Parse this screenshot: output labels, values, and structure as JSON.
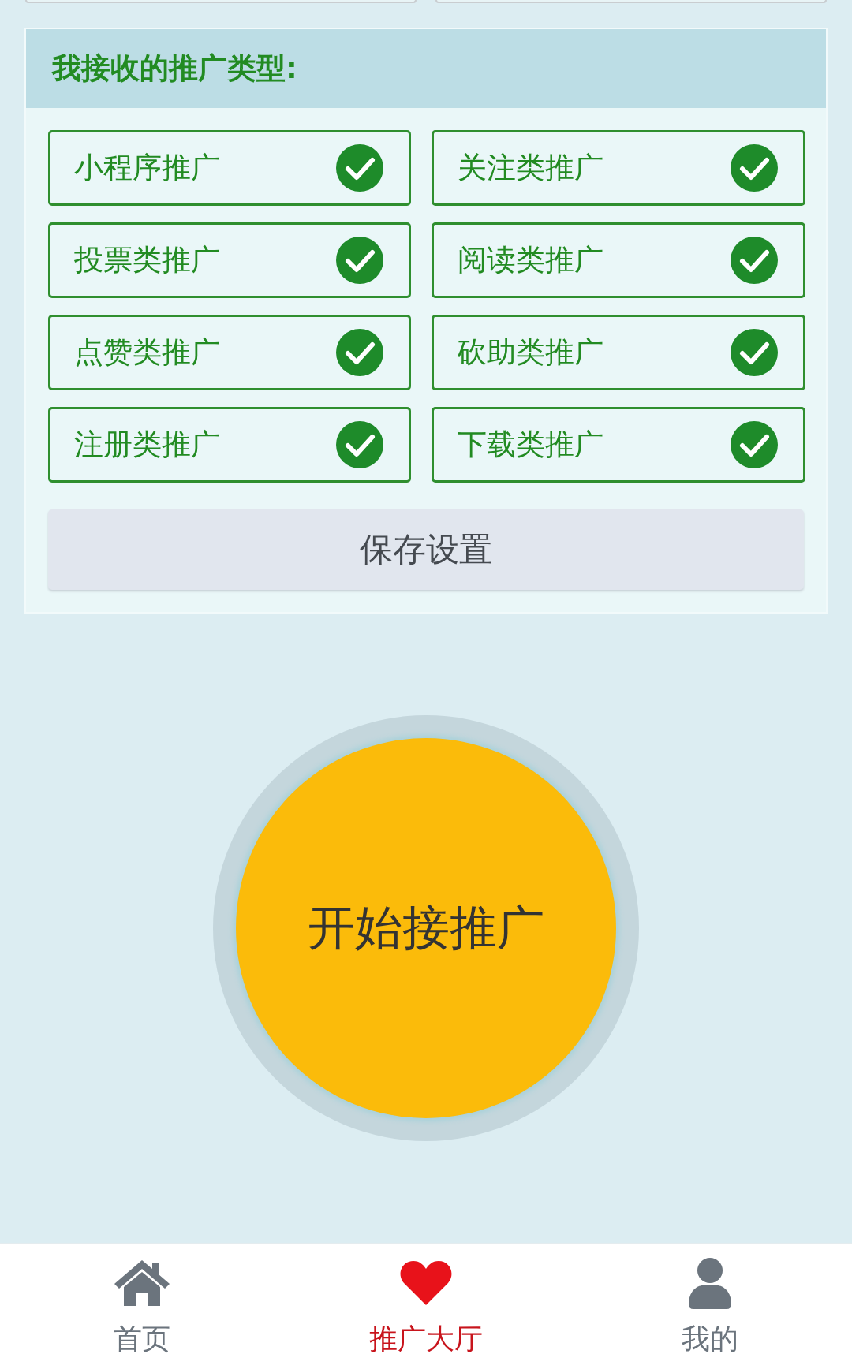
{
  "promo_types": {
    "title": "我接收的推广类型:",
    "options": [
      {
        "label": "小程序推广",
        "checked": true
      },
      {
        "label": "关注类推广",
        "checked": true
      },
      {
        "label": "投票类推广",
        "checked": true
      },
      {
        "label": "阅读类推广",
        "checked": true
      },
      {
        "label": "点赞类推广",
        "checked": true
      },
      {
        "label": "砍助类推广",
        "checked": true
      },
      {
        "label": "注册类推广",
        "checked": true
      },
      {
        "label": "下载类推广",
        "checked": true
      }
    ],
    "save_button": "保存设置"
  },
  "start_button": "开始接推广",
  "tabs": [
    {
      "label": "首页",
      "kind": "home",
      "selected": false
    },
    {
      "label": "推广大厅",
      "kind": "heart",
      "selected": true
    },
    {
      "label": "我的",
      "kind": "user",
      "selected": false
    }
  ]
}
